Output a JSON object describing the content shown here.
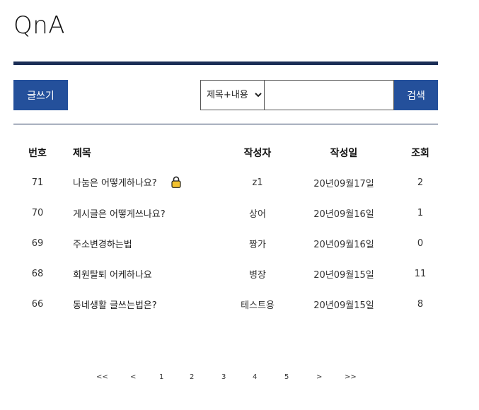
{
  "page": {
    "title": "QnA"
  },
  "toolbar": {
    "write_label": "글쓰기",
    "search_options": [
      "제목+내용"
    ],
    "search_selected": "제목+내용",
    "search_value": "",
    "search_button_label": "검색"
  },
  "table": {
    "headers": {
      "num": "번호",
      "title": "제목",
      "writer": "작성자",
      "date": "작성일",
      "views": "조회"
    },
    "rows": [
      {
        "num": "71",
        "title": "나눔은 어떻게하나요?",
        "locked": true,
        "writer": "z1",
        "date": "20년09월17일",
        "views": "2"
      },
      {
        "num": "70",
        "title": "게시글은 어떻게쓰나요?",
        "locked": false,
        "writer": "상어",
        "date": "20년09월16일",
        "views": "1"
      },
      {
        "num": "69",
        "title": "주소변경하는법",
        "locked": false,
        "writer": "짱가",
        "date": "20년09월16일",
        "views": "0"
      },
      {
        "num": "68",
        "title": "회원탈퇴 어케하나요",
        "locked": false,
        "writer": "병장",
        "date": "20년09월15일",
        "views": "11"
      },
      {
        "num": "66",
        "title": "동네생활 글쓰는법은?",
        "locked": false,
        "writer": "테스트용",
        "date": "20년09월15일",
        "views": "8"
      }
    ]
  },
  "pagination": {
    "first": "<<",
    "prev": "<",
    "pages": [
      "1",
      "2",
      "3",
      "4",
      "5"
    ],
    "next": ">",
    "last": ">>"
  },
  "colors": {
    "primary_button": "#24509b",
    "title_bar": "#1b2e56",
    "lock_icon": "#f2c230"
  },
  "icons": {
    "lock": "lock-icon"
  }
}
